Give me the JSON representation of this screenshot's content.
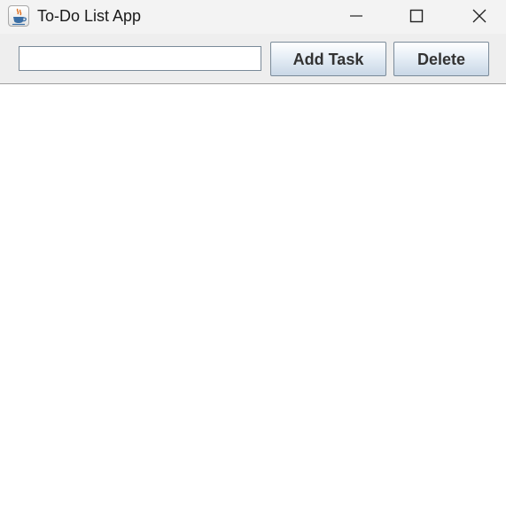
{
  "window": {
    "title": "To-Do List App",
    "icon": "java-cup-icon",
    "controls": {
      "minimize_icon": "minimize-icon",
      "maximize_icon": "maximize-icon",
      "close_icon": "close-icon"
    }
  },
  "toolbar": {
    "task_input_value": "",
    "task_input_placeholder": "",
    "add_label": "Add Task",
    "delete_label": "Delete"
  },
  "task_list": {
    "items": []
  }
}
